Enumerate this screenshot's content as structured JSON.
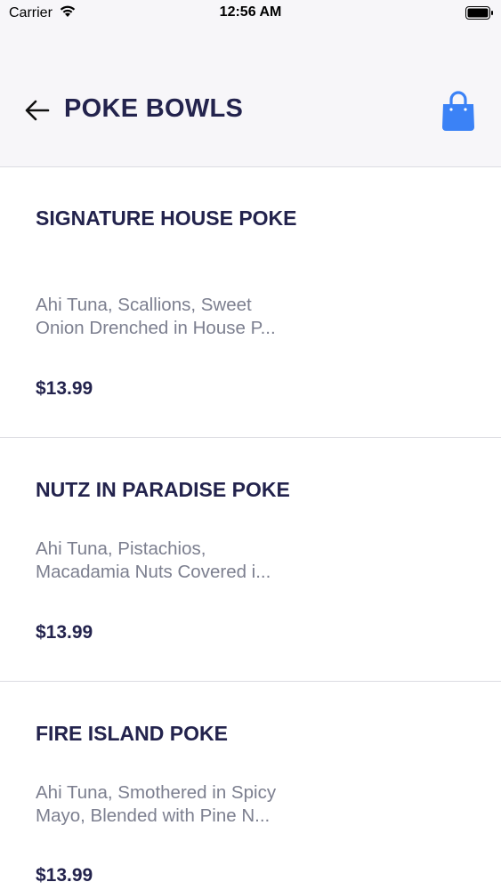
{
  "status_bar": {
    "carrier": "Carrier",
    "time": "12:56 AM"
  },
  "header": {
    "title": "POKE BOWLS",
    "back_icon": "arrow-left-icon",
    "cart_icon": "shopping-bag-icon",
    "accent_color": "#3b82f6"
  },
  "items": [
    {
      "name": "SIGNATURE HOUSE POKE",
      "description_line1": "Ahi Tuna, Scallions, Sweet",
      "description_line2": "Onion Drenched in House P...",
      "price": "$13.99"
    },
    {
      "name": "NUTZ IN PARADISE POKE",
      "description_line1": "Ahi Tuna, Pistachios,",
      "description_line2": "Macadamia Nuts Covered i...",
      "price": "$13.99"
    },
    {
      "name": "FIRE ISLAND POKE",
      "description_line1": "Ahi Tuna, Smothered in Spicy",
      "description_line2": "Mayo, Blended with Pine N...",
      "price": "$13.99"
    }
  ]
}
